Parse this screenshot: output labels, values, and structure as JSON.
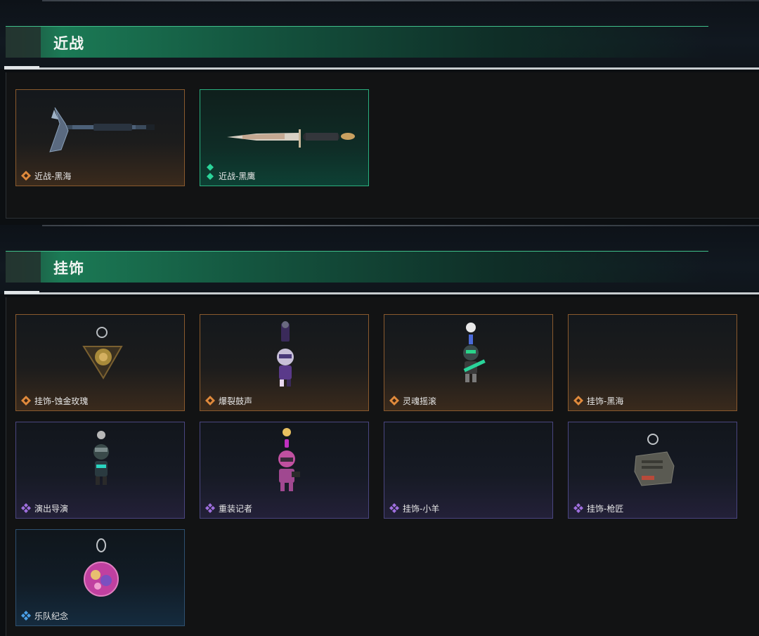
{
  "sections": [
    {
      "title": "近战",
      "items": [
        {
          "label": "近战-黑海",
          "rarity": "orange",
          "icon": "tomahawk-icon"
        },
        {
          "label": "近战-黑鹰",
          "rarity": "green",
          "icon": "dagger-icon"
        }
      ]
    },
    {
      "title": "挂饰",
      "items": [
        {
          "label": "挂饰-蚀金玫瑰",
          "rarity": "orange",
          "icon": "rose-charm-icon"
        },
        {
          "label": "爆裂鼓声",
          "rarity": "orange",
          "icon": "drummer-figure-icon"
        },
        {
          "label": "灵魂摇滚",
          "rarity": "orange",
          "icon": "guitarist-figure-icon"
        },
        {
          "label": "挂饰-黑海",
          "rarity": "orange",
          "icon": "empty-slot"
        },
        {
          "label": "演出导演",
          "rarity": "purple",
          "icon": "director-figure-icon"
        },
        {
          "label": "重装记者",
          "rarity": "purple",
          "icon": "reporter-figure-icon"
        },
        {
          "label": "挂饰-小羊",
          "rarity": "purple",
          "icon": "empty-slot"
        },
        {
          "label": "挂饰-枪匠",
          "rarity": "purple",
          "icon": "gunsmith-charm-icon"
        },
        {
          "label": "乐队纪念",
          "rarity": "blue",
          "icon": "band-badge-icon"
        }
      ]
    }
  ],
  "colors": {
    "orange": "#e08a3c",
    "green": "#2bd49a",
    "purple": "#a070e0",
    "blue": "#4aa0e8"
  }
}
